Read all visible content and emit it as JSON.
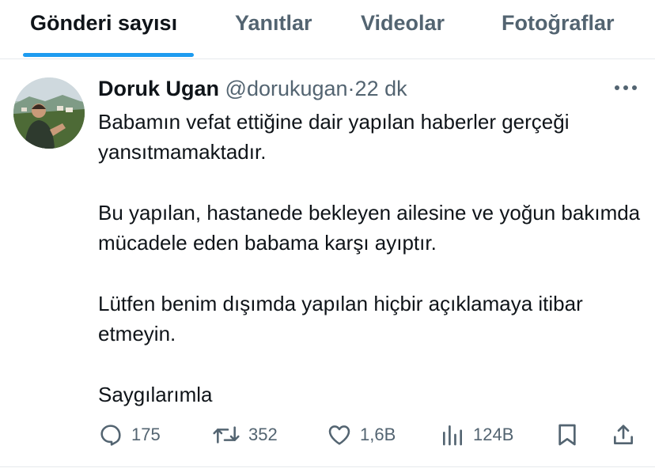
{
  "tabs": [
    {
      "label": "Gönderi sayısı",
      "active": true
    },
    {
      "label": "Yanıtlar"
    },
    {
      "label": "Videolar"
    },
    {
      "label": "Fotoğraflar"
    }
  ],
  "tweet": {
    "display_name": "Doruk Ugan",
    "handle": "@dorukugan",
    "separator": "·",
    "time": "22 dk",
    "paragraphs": [
      "Babamın vefat ettiğine dair yapılan haberler gerçeği yansıtmamaktadır.",
      "Bu yapılan, hastanede bekleyen ailesine ve yoğun bakımda mücadele eden babama karşı ayıptır.",
      "Lütfen benim dışımda yapılan hiçbir açıklamaya itibar etmeyin.",
      "Saygılarımla"
    ]
  },
  "actions": {
    "replies": "175",
    "reposts": "352",
    "likes": "1,6B",
    "views": "124B"
  },
  "icons": {
    "more": "more-horizontal-icon",
    "reply": "reply-icon",
    "repost": "repost-icon",
    "like": "heart-icon",
    "views": "views-chart-icon",
    "bookmark": "bookmark-icon",
    "share": "share-icon"
  },
  "colors": {
    "accent": "#1d9bf0",
    "text": "#0f1419",
    "secondary": "#536471",
    "divider": "#e6e9ec"
  }
}
